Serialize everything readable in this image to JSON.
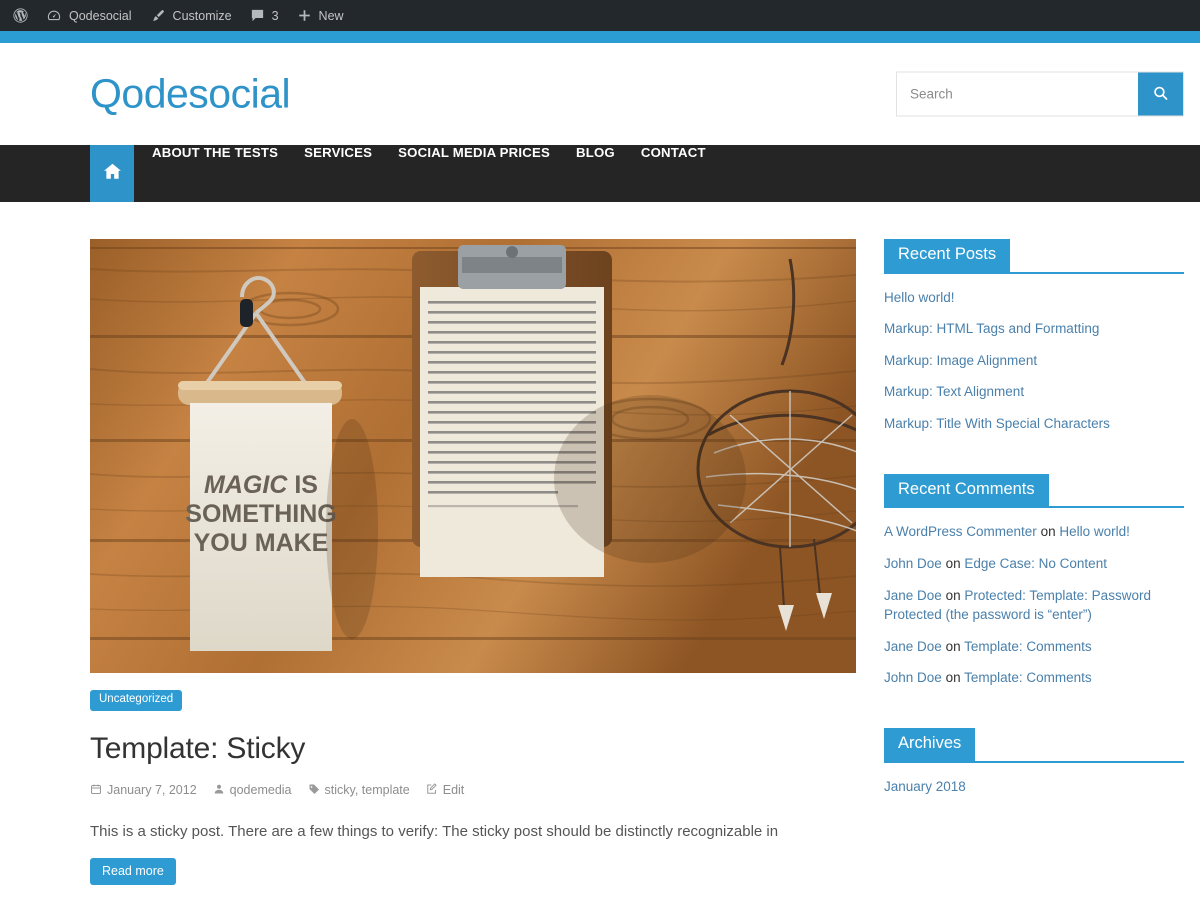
{
  "adminbar": {
    "items": [
      {
        "icon": "wordpress-logo-icon",
        "label": ""
      },
      {
        "icon": "dashboard-speedometer-icon",
        "label": "Qodesocial"
      },
      {
        "icon": "paintbrush-icon",
        "label": "Customize"
      },
      {
        "icon": "comment-bubble-icon",
        "label": "3"
      },
      {
        "icon": "plus-icon",
        "label": "New"
      }
    ]
  },
  "header": {
    "site_title": "Qodesocial",
    "search": {
      "placeholder": "Search",
      "value": "",
      "button_icon": "search-icon"
    }
  },
  "nav": {
    "home_icon": "home-icon",
    "items": [
      {
        "label": "ABOUT THE TESTS"
      },
      {
        "label": "SERVICES"
      },
      {
        "label": "SOCIAL MEDIA PRICES"
      },
      {
        "label": "BLOG"
      },
      {
        "label": "CONTACT"
      }
    ]
  },
  "post": {
    "featured_image_alt": "Wooden wall with a hanger holding a print reading MAGIC IS SOMETHING YOU MAKE, a clipboard with a printed prayer, and a dreamcatcher",
    "featured_print_line1": "MAGIC IS",
    "featured_print_line2": "SOMETHING",
    "featured_print_line3": "YOU MAKE",
    "category": "Uncategorized",
    "title": "Template: Sticky",
    "meta": {
      "date": "January 7, 2012",
      "author": "qodemedia",
      "tags": "sticky, template",
      "edit": "Edit",
      "date_icon": "calendar-icon",
      "author_icon": "user-icon",
      "tags_icon": "tag-icon",
      "edit_icon": "pencil-edit-icon"
    },
    "excerpt": "This is a sticky post. There are a few things to verify: The sticky post should be distinctly recognizable in",
    "read_more": "Read more"
  },
  "sidebar": {
    "recent_posts": {
      "title": "Recent Posts",
      "items": [
        "Hello world!",
        "Markup: HTML Tags and Formatting",
        "Markup: Image Alignment",
        "Markup: Text Alignment",
        "Markup: Title With Special Characters"
      ]
    },
    "recent_comments": {
      "title": "Recent Comments",
      "on_word": "on",
      "items": [
        {
          "author": "A WordPress Commenter",
          "post": "Hello world!"
        },
        {
          "author": "John Doe",
          "post": "Edge Case: No Content"
        },
        {
          "author": "Jane Doe",
          "post": "Protected: Template: Password Protected (the password is “enter”)"
        },
        {
          "author": "Jane Doe",
          "post": "Template: Comments"
        },
        {
          "author": "John Doe",
          "post": "Template: Comments"
        }
      ]
    },
    "archives": {
      "title": "Archives",
      "items": [
        "January 2018"
      ]
    }
  },
  "colors": {
    "accent_blue": "#2e93c9",
    "widget_blue": "#2e9bd2",
    "admin_dark": "#23282d",
    "nav_dark": "#252525",
    "link_blue": "#4a80ab"
  }
}
